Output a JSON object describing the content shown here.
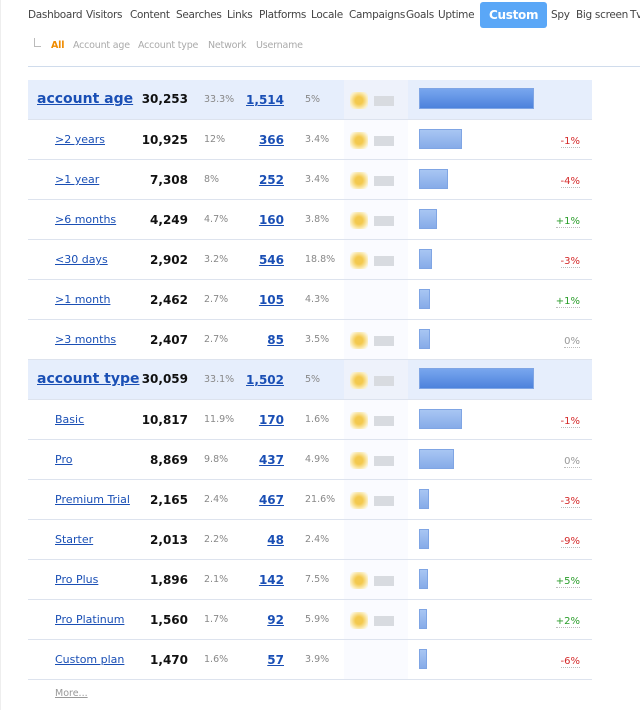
{
  "nav": [
    "Dashboard",
    "Visitors",
    "Content",
    "Searches",
    "Links",
    "Platforms",
    "Locale",
    "Campaigns",
    "Goals",
    "Uptime",
    "Custom",
    "Spy",
    "Big screen",
    "Tv"
  ],
  "nav_active": "Custom",
  "subnav": [
    "All",
    "Account age",
    "Account type",
    "Network",
    "Username"
  ],
  "subnav_active": "All",
  "groups": [
    {
      "label": "account age",
      "value": "30,253",
      "pct": "33.3%",
      "count": "1,514",
      "count_pct": "5%",
      "thumb": true,
      "rows": [
        {
          "label": ">2 years",
          "value": "10,925",
          "pct": "12%",
          "count": "366",
          "count_pct": "3.4%",
          "thumb": true,
          "change": "-1%",
          "trend": "down"
        },
        {
          "label": ">1 year",
          "value": "7,308",
          "pct": "8%",
          "count": "252",
          "count_pct": "3.4%",
          "thumb": true,
          "change": "-4%",
          "trend": "down"
        },
        {
          "label": ">6 months",
          "value": "4,249",
          "pct": "4.7%",
          "count": "160",
          "count_pct": "3.8%",
          "thumb": true,
          "change": "+1%",
          "trend": "up"
        },
        {
          "label": "<30 days",
          "value": "2,902",
          "pct": "3.2%",
          "count": "546",
          "count_pct": "18.8%",
          "thumb": true,
          "change": "-3%",
          "trend": "down"
        },
        {
          "label": ">1 month",
          "value": "2,462",
          "pct": "2.7%",
          "count": "105",
          "count_pct": "4.3%",
          "thumb": false,
          "change": "+1%",
          "trend": "up"
        },
        {
          "label": ">3 months",
          "value": "2,407",
          "pct": "2.7%",
          "count": "85",
          "count_pct": "3.5%",
          "thumb": true,
          "change": "0%",
          "trend": "flat"
        }
      ]
    },
    {
      "label": "account type",
      "value": "30,059",
      "pct": "33.1%",
      "count": "1,502",
      "count_pct": "5%",
      "thumb": true,
      "rows": [
        {
          "label": "Basic",
          "value": "10,817",
          "pct": "11.9%",
          "count": "170",
          "count_pct": "1.6%",
          "thumb": true,
          "change": "-1%",
          "trend": "down"
        },
        {
          "label": "Pro",
          "value": "8,869",
          "pct": "9.8%",
          "count": "437",
          "count_pct": "4.9%",
          "thumb": true,
          "change": "0%",
          "trend": "flat"
        },
        {
          "label": "Premium Trial",
          "value": "2,165",
          "pct": "2.4%",
          "count": "467",
          "count_pct": "21.6%",
          "thumb": true,
          "change": "-3%",
          "trend": "down"
        },
        {
          "label": "Starter",
          "value": "2,013",
          "pct": "2.2%",
          "count": "48",
          "count_pct": "2.4%",
          "thumb": false,
          "change": "-9%",
          "trend": "down"
        },
        {
          "label": "Pro Plus",
          "value": "1,896",
          "pct": "2.1%",
          "count": "142",
          "count_pct": "7.5%",
          "thumb": true,
          "change": "+5%",
          "trend": "up"
        },
        {
          "label": "Pro Platinum",
          "value": "1,560",
          "pct": "1.7%",
          "count": "92",
          "count_pct": "5.9%",
          "thumb": true,
          "change": "+2%",
          "trend": "up"
        },
        {
          "label": "Custom plan",
          "value": "1,470",
          "pct": "1.6%",
          "count": "57",
          "count_pct": "3.9%",
          "thumb": false,
          "change": "-6%",
          "trend": "down"
        }
      ]
    }
  ],
  "more_label": "More..."
}
